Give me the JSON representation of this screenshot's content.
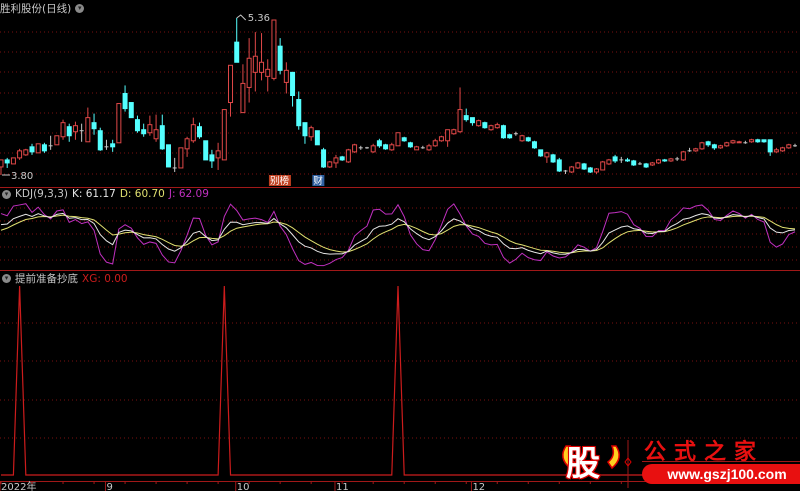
{
  "header": {
    "title": "胜利股份(日线)",
    "menu_icon": "chevron-down-circle-icon"
  },
  "main_panel": {
    "max_label": "5.36",
    "min_label": "3.80",
    "markers": [
      {
        "text": "别榜",
        "color": "#c04020"
      },
      {
        "text": "财",
        "color": "#3060a0"
      }
    ]
  },
  "kdj_panel": {
    "name": "KDJ(9,3,3)",
    "k_label": "K: 61.17",
    "d_label": "D: 60.70",
    "j_label": "J: 62.09",
    "colors": {
      "k": "#e6e6e6",
      "d": "#e0e070",
      "j": "#c030c0"
    }
  },
  "xg_panel": {
    "name": "提前准备抄底",
    "xg_label": "XG: 0.00",
    "color": "#cc1c1c"
  },
  "time_axis": {
    "labels": [
      "2022年",
      "9",
      "10",
      "11",
      "12"
    ]
  },
  "logo": {
    "glyph": "股",
    "name": "公式之家",
    "url": "www.gszj100.com"
  },
  "colors": {
    "up": "#e04848",
    "down": "#54ffff",
    "grid": "#7a1010",
    "border": "#a01818"
  },
  "chart_data": {
    "type": "candlestick",
    "title": "胜利股份(日线)",
    "ylim": [
      3.8,
      5.36
    ],
    "candle_format": [
      "open",
      "close",
      "high",
      "low"
    ],
    "candles": [
      [
        3.88,
        3.95,
        3.95,
        3.8
      ],
      [
        3.95,
        3.92,
        3.97,
        3.87
      ],
      [
        3.91,
        3.97,
        3.97,
        3.91
      ],
      [
        3.97,
        4.04,
        4.06,
        3.95
      ],
      [
        4.0,
        4.05,
        4.06,
        3.99
      ],
      [
        4.08,
        4.03,
        4.11,
        4.0
      ],
      [
        4.02,
        4.11,
        4.11,
        4.02
      ],
      [
        4.1,
        4.04,
        4.12,
        4.02
      ],
      [
        4.09,
        4.09,
        4.19,
        4.05
      ],
      [
        4.1,
        4.19,
        4.19,
        4.1
      ],
      [
        4.18,
        4.32,
        4.35,
        4.15
      ],
      [
        4.28,
        4.19,
        4.31,
        4.13
      ],
      [
        4.23,
        4.29,
        4.33,
        4.15
      ],
      [
        4.24,
        4.24,
        4.31,
        4.13
      ],
      [
        4.13,
        4.37,
        4.47,
        4.13
      ],
      [
        4.32,
        4.26,
        4.41,
        4.2
      ],
      [
        4.24,
        4.05,
        4.27,
        4.04
      ],
      [
        4.08,
        4.08,
        4.15,
        4.05
      ],
      [
        4.11,
        4.08,
        4.15,
        4.03
      ],
      [
        4.12,
        4.51,
        4.51,
        4.12
      ],
      [
        4.61,
        4.46,
        4.69,
        4.43
      ],
      [
        4.52,
        4.37,
        4.52,
        4.37
      ],
      [
        4.35,
        4.24,
        4.39,
        4.22
      ],
      [
        4.25,
        4.21,
        4.31,
        4.18
      ],
      [
        4.22,
        4.3,
        4.39,
        4.19
      ],
      [
        4.16,
        4.25,
        4.4,
        4.13
      ],
      [
        4.29,
        4.06,
        4.4,
        4.05
      ],
      [
        4.1,
        3.88,
        4.1,
        3.88
      ],
      [
        3.87,
        3.87,
        3.97,
        3.83
      ],
      [
        3.87,
        4.07,
        4.07,
        3.87
      ],
      [
        4.06,
        4.16,
        4.18,
        3.98
      ],
      [
        4.14,
        4.3,
        4.37,
        4.12
      ],
      [
        4.28,
        4.18,
        4.32,
        4.16
      ],
      [
        4.14,
        3.95,
        4.14,
        3.95
      ],
      [
        4.0,
        3.94,
        4.05,
        3.87
      ],
      [
        3.97,
        4.04,
        4.12,
        3.85
      ],
      [
        3.95,
        4.45,
        4.45,
        3.95
      ],
      [
        4.52,
        4.89,
        4.89,
        4.38
      ],
      [
        5.12,
        4.92,
        5.36,
        4.92
      ],
      [
        4.42,
        4.71,
        4.9,
        4.42
      ],
      [
        4.67,
        4.96,
        5.16,
        4.52
      ],
      [
        4.82,
        4.98,
        5.22,
        4.63
      ],
      [
        4.82,
        4.92,
        5.21,
        4.74
      ],
      [
        4.78,
        4.85,
        4.95,
        4.63
      ],
      [
        4.76,
        5.34,
        5.34,
        4.74
      ],
      [
        5.08,
        4.84,
        5.16,
        4.8
      ],
      [
        4.72,
        4.84,
        4.92,
        4.61
      ],
      [
        4.82,
        4.59,
        4.82,
        4.48
      ],
      [
        4.55,
        4.29,
        4.63,
        4.25
      ],
      [
        4.32,
        4.19,
        4.32,
        4.11
      ],
      [
        4.18,
        4.27,
        4.29,
        4.14
      ],
      [
        4.24,
        4.1,
        4.24,
        4.1
      ],
      [
        4.05,
        3.88,
        4.07,
        3.87
      ],
      [
        3.88,
        3.93,
        3.94,
        3.87
      ],
      [
        3.92,
        3.97,
        4.0,
        3.87
      ],
      [
        3.98,
        3.95,
        3.99,
        3.94
      ],
      [
        3.93,
        4.05,
        4.06,
        3.92
      ],
      [
        4.03,
        4.1,
        4.11,
        4.02
      ],
      [
        4.07,
        4.07,
        4.09,
        4.05
      ],
      [
        4.07,
        4.07,
        4.08,
        4.06
      ],
      [
        4.03,
        4.09,
        4.11,
        4.02
      ],
      [
        4.14,
        4.09,
        4.16,
        4.07
      ],
      [
        4.1,
        4.06,
        4.11,
        4.05
      ],
      [
        4.05,
        4.1,
        4.12,
        4.04
      ],
      [
        4.09,
        4.22,
        4.22,
        4.09
      ],
      [
        4.17,
        4.14,
        4.18,
        4.13
      ],
      [
        4.12,
        4.08,
        4.13,
        4.07
      ],
      [
        4.05,
        4.08,
        4.09,
        4.05
      ],
      [
        4.07,
        4.07,
        4.09,
        4.06
      ],
      [
        4.05,
        4.09,
        4.11,
        4.04
      ],
      [
        4.09,
        4.14,
        4.16,
        4.08
      ],
      [
        4.14,
        4.18,
        4.19,
        4.13
      ],
      [
        4.14,
        4.25,
        4.25,
        4.08
      ],
      [
        4.21,
        4.25,
        4.26,
        4.2
      ],
      [
        4.23,
        4.45,
        4.67,
        4.22
      ],
      [
        4.39,
        4.35,
        4.46,
        4.33
      ],
      [
        4.37,
        4.32,
        4.37,
        4.29
      ],
      [
        4.29,
        4.34,
        4.35,
        4.28
      ],
      [
        4.32,
        4.27,
        4.33,
        4.26
      ],
      [
        4.25,
        4.29,
        4.3,
        4.24
      ],
      [
        4.27,
        4.3,
        4.32,
        4.26
      ],
      [
        4.29,
        4.17,
        4.3,
        4.16
      ],
      [
        4.2,
        4.17,
        4.21,
        4.16
      ],
      [
        4.21,
        4.21,
        4.23,
        4.19
      ],
      [
        4.14,
        4.19,
        4.2,
        4.13
      ],
      [
        4.17,
        4.14,
        4.18,
        4.13
      ],
      [
        4.13,
        4.07,
        4.14,
        4.06
      ],
      [
        4.05,
        3.99,
        4.05,
        3.98
      ],
      [
        3.98,
        4.02,
        4.03,
        3.92
      ],
      [
        4.0,
        3.93,
        4.01,
        3.92
      ],
      [
        3.95,
        3.84,
        3.97,
        3.83
      ],
      [
        3.84,
        3.84,
        3.85,
        3.81
      ],
      [
        3.83,
        3.88,
        3.89,
        3.82
      ],
      [
        3.87,
        3.92,
        3.93,
        3.86
      ],
      [
        3.91,
        3.86,
        3.92,
        3.85
      ],
      [
        3.87,
        3.83,
        3.88,
        3.82
      ],
      [
        3.83,
        3.86,
        3.87,
        3.81
      ],
      [
        3.85,
        3.93,
        3.94,
        3.85
      ],
      [
        3.91,
        3.95,
        3.96,
        3.9
      ],
      [
        3.98,
        3.94,
        4.0,
        3.92
      ],
      [
        3.95,
        3.95,
        3.98,
        3.92
      ],
      [
        3.95,
        3.94,
        3.97,
        3.93
      ],
      [
        3.94,
        3.9,
        3.95,
        3.89
      ],
      [
        3.91,
        3.91,
        3.93,
        3.9
      ],
      [
        3.91,
        3.88,
        3.92,
        3.87
      ],
      [
        3.9,
        3.92,
        3.93,
        3.89
      ],
      [
        3.92,
        3.95,
        3.96,
        3.91
      ],
      [
        3.95,
        3.94,
        3.96,
        3.93
      ],
      [
        3.94,
        3.96,
        3.97,
        3.93
      ],
      [
        3.96,
        3.96,
        3.98,
        3.94
      ],
      [
        3.95,
        4.03,
        4.04,
        3.94
      ],
      [
        4.04,
        4.04,
        4.07,
        4.03
      ],
      [
        4.04,
        4.06,
        4.07,
        4.03
      ],
      [
        4.06,
        4.12,
        4.13,
        4.05
      ],
      [
        4.13,
        4.1,
        4.14,
        4.08
      ],
      [
        4.1,
        4.07,
        4.11,
        4.05
      ],
      [
        4.07,
        4.09,
        4.1,
        4.06
      ],
      [
        4.09,
        4.12,
        4.13,
        4.08
      ],
      [
        4.12,
        4.14,
        4.15,
        4.11
      ],
      [
        4.12,
        4.13,
        4.14,
        4.12
      ],
      [
        4.12,
        4.12,
        4.14,
        4.11
      ],
      [
        4.13,
        4.15,
        4.16,
        4.12
      ],
      [
        4.15,
        4.13,
        4.16,
        4.12
      ],
      [
        4.15,
        4.13,
        4.15,
        4.12
      ],
      [
        4.15,
        4.03,
        4.15,
        3.99
      ],
      [
        4.03,
        4.05,
        4.07,
        4.02
      ],
      [
        4.04,
        4.07,
        4.08,
        4.03
      ],
      [
        4.07,
        4.1,
        4.11,
        4.06
      ],
      [
        4.09,
        4.09,
        4.11,
        4.08
      ]
    ],
    "max_index": 38,
    "min_index": 0,
    "marker_indices": [
      44,
      51
    ],
    "axis_label_indices": [
      0,
      17,
      38,
      54,
      76
    ],
    "kdj": {
      "n": 9,
      "m1": 3,
      "m2": 3,
      "last": {
        "K": 61.17,
        "D": 60.7,
        "J": 62.09
      }
    },
    "xg": {
      "signal_indices": [
        3,
        36,
        64
      ],
      "last": 0.0
    }
  }
}
